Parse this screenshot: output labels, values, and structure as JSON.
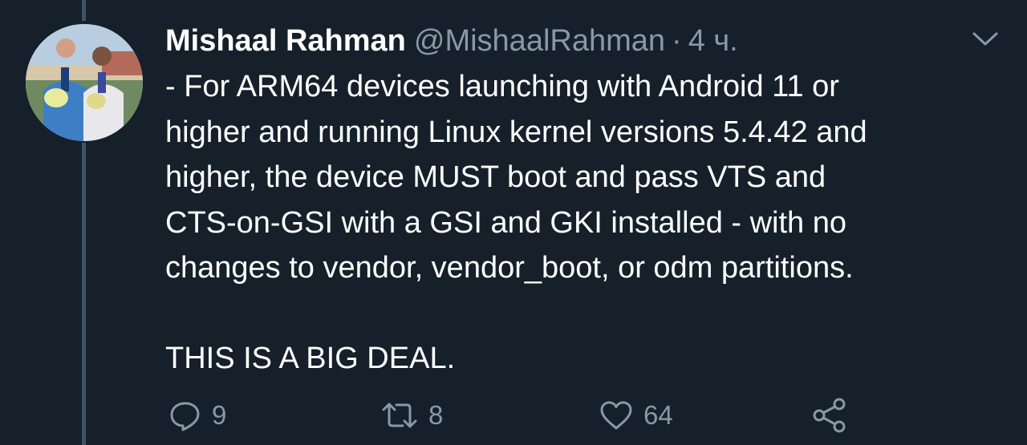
{
  "tweet": {
    "author": {
      "display_name": "Mishaal Rahman",
      "handle": "@MishaalRahman"
    },
    "separator": "·",
    "time": "4 ч.",
    "body_lines": [
      "- For ARM64 devices launching with Android 11 or",
      "higher and running Linux kernel versions 5.4.42 and",
      "higher, the device MUST boot and pass VTS and",
      "CTS-on-GSI with a GSI and GKI installed - with no",
      "changes to vendor, vendor_boot, or odm partitions."
    ],
    "body_emphasis": "THIS IS A BIG DEAL.",
    "actions": {
      "reply": {
        "icon": "reply-icon",
        "count": "9"
      },
      "retweet": {
        "icon": "retweet-icon",
        "count": "8"
      },
      "like": {
        "icon": "heart-icon",
        "count": "64"
      },
      "share": {
        "icon": "share-icon"
      }
    }
  },
  "colors": {
    "background": "#15202b",
    "primary_text": "#ffffff",
    "secondary_text": "#8899a6",
    "thread_line": "#3d5466"
  }
}
